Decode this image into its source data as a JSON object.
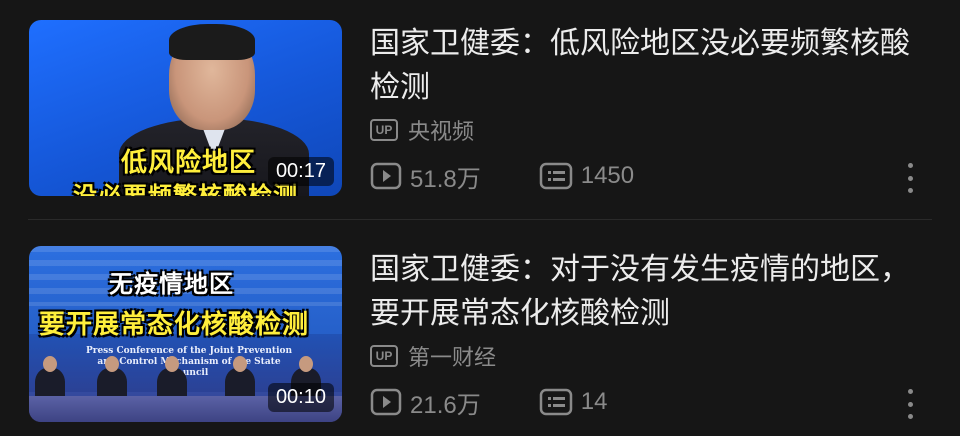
{
  "videos": [
    {
      "title": "国家卫健委：低风险地区没必要频繁核酸检测",
      "uploader": "央视频",
      "up_badge": "UP",
      "duration": "00:17",
      "views": "51.8万",
      "comments": "1450",
      "thumb_caption_1": "低风险地区",
      "thumb_caption_2": "没必要频繁核酸检测"
    },
    {
      "title": "国家卫健委：对于没有发生疫情的地区，要开展常态化核酸检测",
      "uploader": "第一财经",
      "up_badge": "UP",
      "duration": "00:10",
      "views": "21.6万",
      "comments": "14",
      "thumb_caption_1": "无疫情地区",
      "thumb_caption_2": "要开展常态化核酸检测",
      "thumb_english": "Press Conference of the Joint Prevention and Control Mechanism of the State Council"
    }
  ],
  "icons": {
    "play": "play-icon",
    "comment": "comment-icon",
    "more": "more-vertical-icon"
  }
}
